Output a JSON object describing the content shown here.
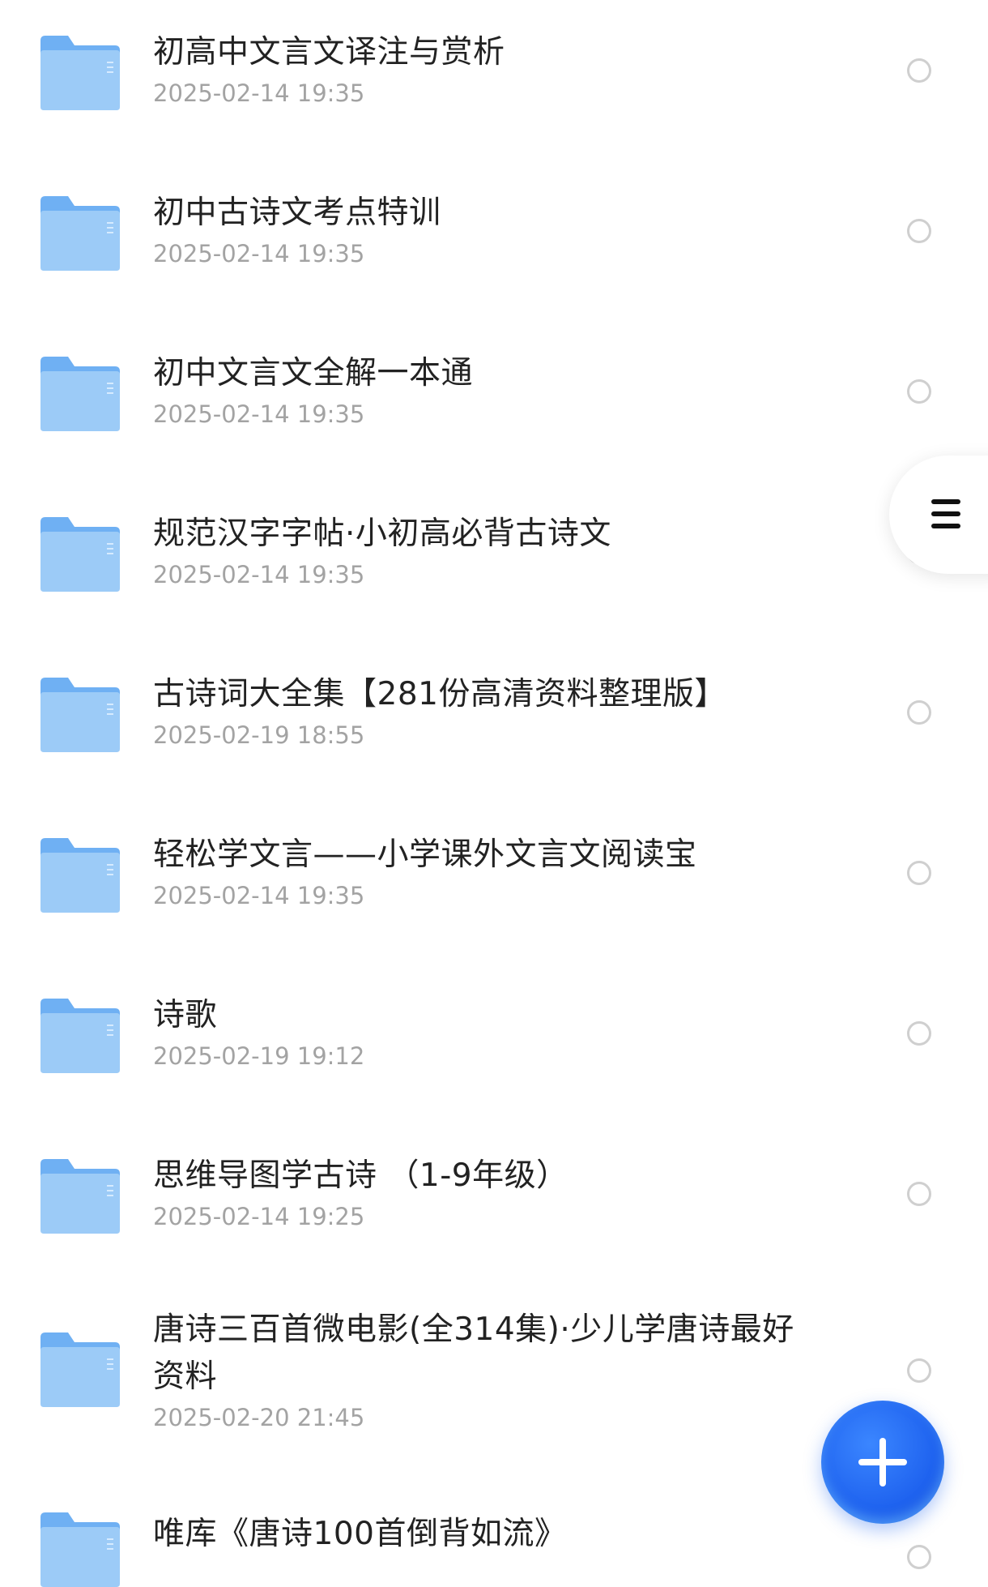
{
  "files": [
    {
      "name": "初高中文言文译注与赏析",
      "time": "2025-02-14 19:35"
    },
    {
      "name": "初中古诗文考点特训",
      "time": "2025-02-14 19:35"
    },
    {
      "name": "初中文言文全解一本通",
      "time": "2025-02-14 19:35"
    },
    {
      "name": "规范汉字字帖·小初高必背古诗文",
      "time": "2025-02-14 19:35"
    },
    {
      "name": "古诗词大全集【281份高清资料整理版】",
      "time": "2025-02-19 18:55"
    },
    {
      "name": "轻松学文言——小学课外文言文阅读宝",
      "time": "2025-02-14 19:35"
    },
    {
      "name": "诗歌",
      "time": "2025-02-19 19:12"
    },
    {
      "name": "思维导图学古诗 （1-9年级）",
      "time": "2025-02-14 19:25"
    },
    {
      "name": "唐诗三百首微电影(全314集)·少儿学唐诗最好资料",
      "time": "2025-02-20 21:45"
    },
    {
      "name": "唯库《唐诗100首倒背如流》",
      "time": ""
    }
  ],
  "icons": {
    "folder": "folder-icon",
    "select": "radio-circle-icon",
    "menu": "menu-icon",
    "add": "plus-icon"
  },
  "colors": {
    "folder_top": "#7fb8f5",
    "folder_front": "#9ccbf7",
    "fab": "#1f63ef"
  }
}
